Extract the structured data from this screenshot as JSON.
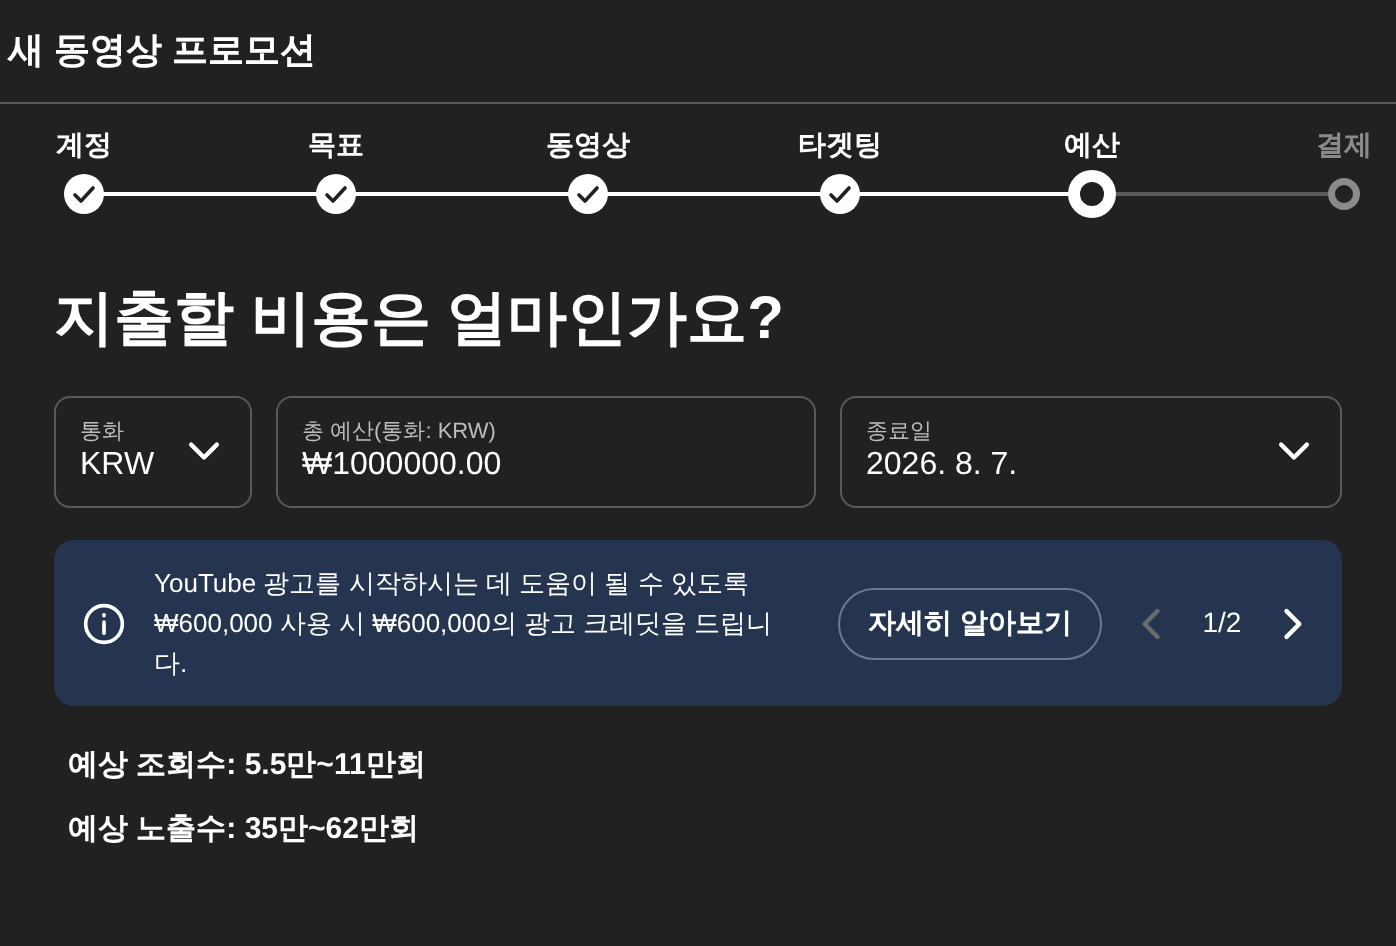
{
  "header": {
    "title": "새 동영상 프로모션"
  },
  "steps": [
    {
      "label": "계정",
      "kind": "done"
    },
    {
      "label": "목표",
      "kind": "done"
    },
    {
      "label": "동영상",
      "kind": "done"
    },
    {
      "label": "타겟팅",
      "kind": "done"
    },
    {
      "label": "예산",
      "kind": "current"
    },
    {
      "label": "결제",
      "kind": "pending"
    }
  ],
  "heading": "지출할 비용은 얼마인가요?",
  "fields": [
    {
      "kind": "select",
      "label": "통화",
      "value": "KRW"
    },
    {
      "kind": "text",
      "label": "총 예산(통화: KRW)",
      "value": "₩1000000.00"
    },
    {
      "kind": "select",
      "label": "종료일",
      "value": "2026. 8. 7."
    }
  ],
  "banner": {
    "text": "YouTube 광고를 시작하시는 데 도움이 될 수 있도록 ₩600,000 사용 시 ₩600,000의 광고 크레딧을 드립니다.",
    "button": "자세히 알아보기",
    "page": "1/2",
    "prev_disabled": true,
    "next_disabled": false
  },
  "estimates": [
    "예상 조회수: 5.5만~11만회",
    "예상 노출수: 35만~62만회"
  ]
}
